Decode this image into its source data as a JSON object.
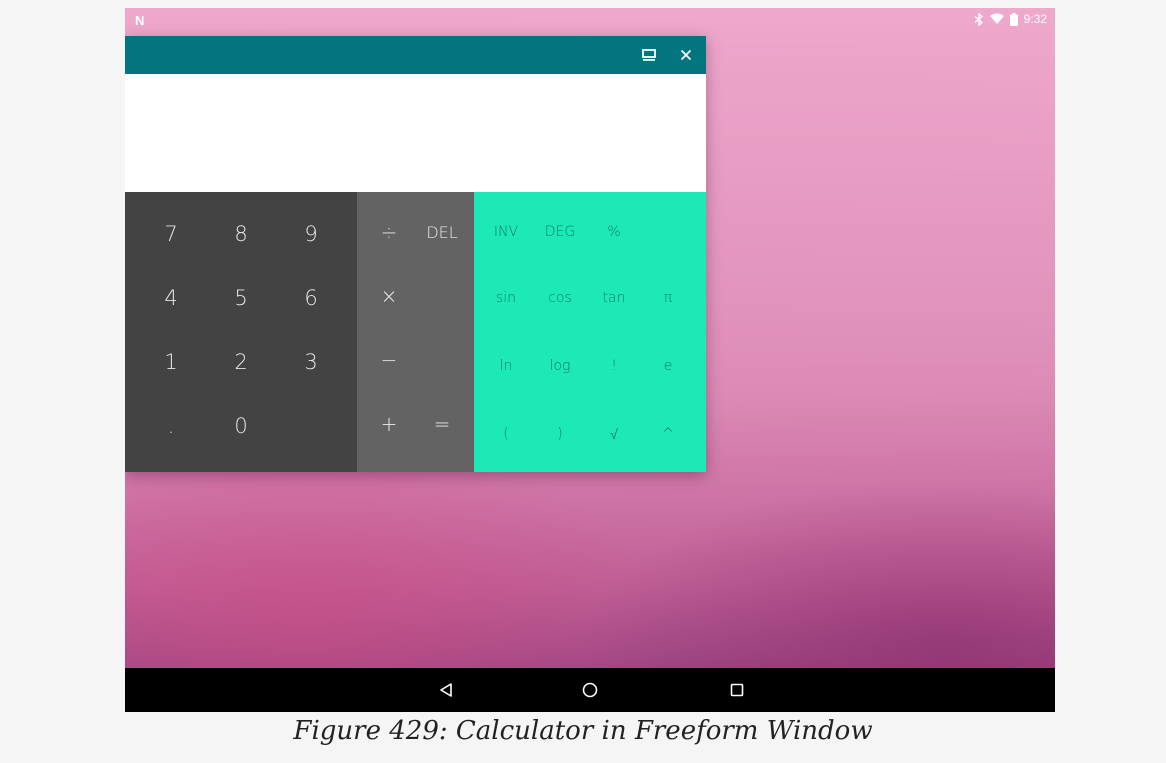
{
  "status_bar": {
    "logo": "N",
    "time": "9:32",
    "icons": [
      "bluetooth-icon",
      "wifi-icon",
      "battery-icon"
    ]
  },
  "window": {
    "title_bar_color": "#03757f",
    "buttons": [
      "maximize-icon",
      "close-icon"
    ],
    "display_value": ""
  },
  "keypad": {
    "numeric": [
      [
        "7",
        "8",
        "9"
      ],
      [
        "4",
        "5",
        "6"
      ],
      [
        "1",
        "2",
        "3"
      ],
      [
        ".",
        "0"
      ]
    ],
    "operators": {
      "divide": "÷",
      "delete": "DEL",
      "multiply": "×",
      "subtract": "−",
      "add": "+",
      "equals": "="
    },
    "advanced": [
      [
        "INV",
        "DEG",
        "%"
      ],
      [
        "sin",
        "cos",
        "tan",
        "π"
      ],
      [
        "ln",
        "log",
        "!",
        "e"
      ],
      [
        "(",
        ")",
        "√",
        "^"
      ]
    ],
    "colors": {
      "numeric_bg": "#434343",
      "operator_bg": "#636363",
      "advanced_bg": "#1de9b6"
    }
  },
  "nav_bar": {
    "buttons": [
      "back-icon",
      "home-icon",
      "recents-icon"
    ]
  },
  "caption": "Figure 429: Calculator in Freeform Window"
}
